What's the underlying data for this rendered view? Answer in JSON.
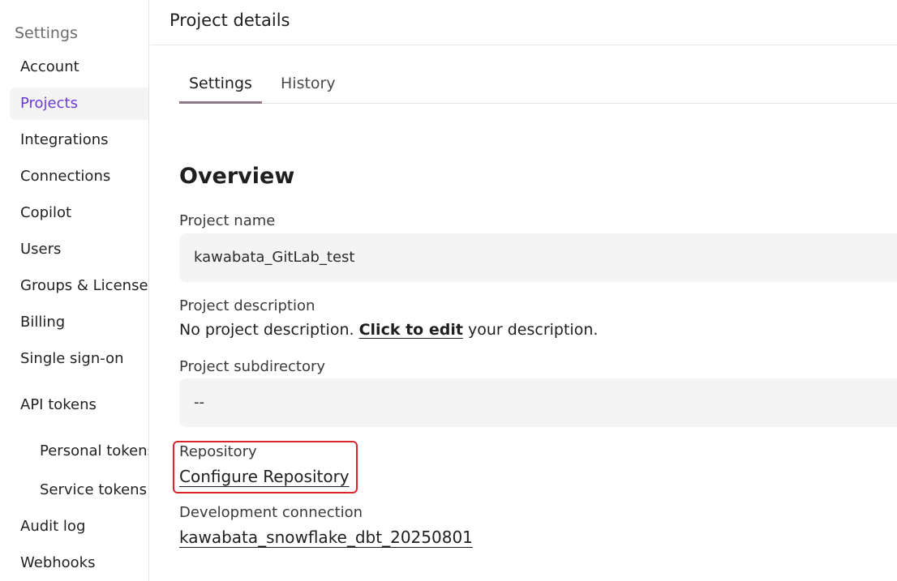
{
  "sidebar": {
    "heading": "Settings",
    "items": [
      {
        "label": "Account"
      },
      {
        "label": "Projects",
        "active": true
      },
      {
        "label": "Integrations"
      },
      {
        "label": "Connections"
      },
      {
        "label": "Copilot"
      },
      {
        "label": "Users"
      },
      {
        "label": "Groups & Licenses"
      },
      {
        "label": "Billing"
      },
      {
        "label": "Single sign-on"
      },
      {
        "label": "API tokens"
      },
      {
        "label": "Personal tokens"
      },
      {
        "label": "Service tokens"
      },
      {
        "label": "Audit log"
      },
      {
        "label": "Webhooks"
      }
    ]
  },
  "header": {
    "title": "Project details"
  },
  "tabs": [
    {
      "label": "Settings",
      "active": true
    },
    {
      "label": "History"
    }
  ],
  "overview": {
    "title": "Overview",
    "project_name": {
      "label": "Project name",
      "value": "kawabata_GitLab_test"
    },
    "project_description": {
      "label": "Project description",
      "prefix": "No project description. ",
      "link": "Click to edit",
      "suffix": " your description."
    },
    "project_subdirectory": {
      "label": "Project subdirectory",
      "value": "--"
    },
    "repository": {
      "label": "Repository",
      "link": "Configure Repository"
    },
    "development_connection": {
      "label": "Development connection",
      "link": "kawabata_snowflake_dbt_20250801"
    }
  },
  "colors": {
    "accent": "#6a3bd6",
    "highlight": "#d9262c"
  }
}
